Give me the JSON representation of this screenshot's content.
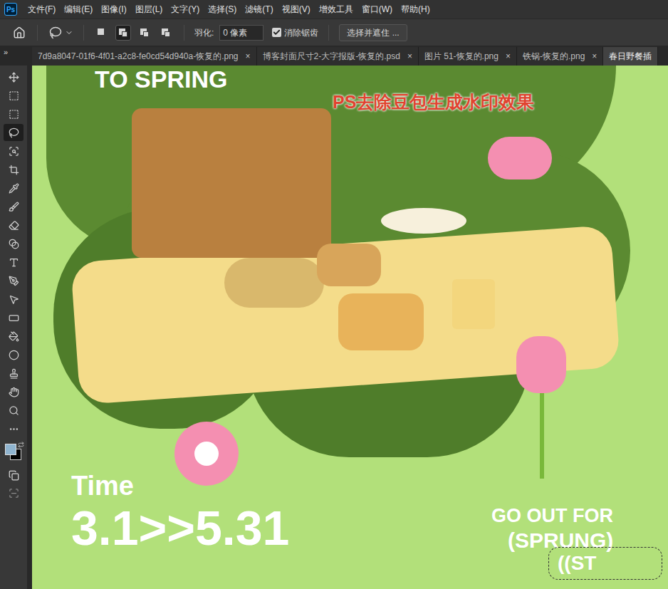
{
  "app": {
    "logo": "Ps"
  },
  "menu": [
    "文件(F)",
    "编辑(E)",
    "图像(I)",
    "图层(L)",
    "文字(Y)",
    "选择(S)",
    "滤镜(T)",
    "视图(V)",
    "增效工具",
    "窗口(W)",
    "帮助(H)"
  ],
  "options": {
    "modes": [
      {
        "selected": false
      },
      {
        "selected": true
      },
      {
        "selected": false
      },
      {
        "selected": false
      }
    ],
    "feather_label": "羽化:",
    "feather_value": "0 像素",
    "antialias": {
      "label": "消除锯齿",
      "checked": true
    },
    "mask_button": "选择并遮住 ..."
  },
  "tabs_overflow": "»",
  "tabs": [
    {
      "label": "7d9a8047-01f6-4f01-a2c8-fe0cd54d940a-恢复的.png",
      "close": "×",
      "selected": false
    },
    {
      "label": "博客封面尺寸2-大字报版-恢复的.psd",
      "close": "×",
      "selected": false
    },
    {
      "label": "图片 51-恢复的.png",
      "close": "×",
      "selected": false
    },
    {
      "label": "铁锅-恢复的.png",
      "close": "×",
      "selected": false
    },
    {
      "label": "春日野餐插",
      "close": "",
      "selected": true
    }
  ],
  "tools": [
    {
      "selected": false
    },
    {
      "selected": false
    },
    {
      "selected": false
    },
    {
      "selected": true
    },
    {
      "selected": false
    },
    {
      "selected": false
    },
    {
      "selected": false
    },
    {
      "selected": false
    },
    {
      "selected": false
    },
    {
      "selected": false
    },
    {
      "selected": false
    },
    {
      "selected": false
    },
    {
      "selected": false
    },
    {
      "selected": false
    },
    {
      "selected": false
    },
    {
      "selected": false
    },
    {
      "selected": false
    },
    {
      "selected": false
    },
    {
      "selected": false
    },
    {
      "selected": false
    }
  ],
  "swatches": {
    "foreground": "#8fb4cf",
    "background": "#000000"
  },
  "canvas": {
    "top_title": "TO SPRING",
    "watermark_note": "PS去除豆包生成水印效果",
    "time_label": "Time",
    "date_range": "3.1>>5.31",
    "tagline": "GO OUT FOR",
    "tagline_word": "(SPRUNG)",
    "residue": "((ST"
  }
}
